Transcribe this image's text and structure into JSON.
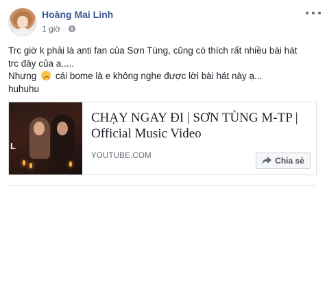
{
  "post": {
    "author": "Hoàng Mai Linh",
    "time": "1 giờ",
    "separator": "·",
    "privacy_icon": "globe-icon",
    "more_icon": "more-options-icon",
    "text": {
      "line1": "Trc giờ k phải là anti fan của Sơn Tùng, cũng có thích rất nhiều bài hát",
      "line2": "trc đây của a.....",
      "line3_start": "Nhưng",
      "line3_emoji": "sad-face-emoji",
      "line3_end": "cái bome là e không nghe được lời bài hát này ạ...",
      "line4": "huhuhu"
    },
    "link_card": {
      "title": "CHẠY NGAY ĐI | SƠN TÙNG M-TP | Official Music Video",
      "domain": "YOUTUBE.COM",
      "thumbnail_letter": "L",
      "share_label": "Chia sẻ",
      "share_icon": "share-arrow-icon"
    }
  },
  "colors": {
    "author_name": "#385898",
    "text": "#1d2129",
    "muted": "#616770",
    "border": "#dddfe2",
    "button_bg": "#f5f6f7"
  }
}
